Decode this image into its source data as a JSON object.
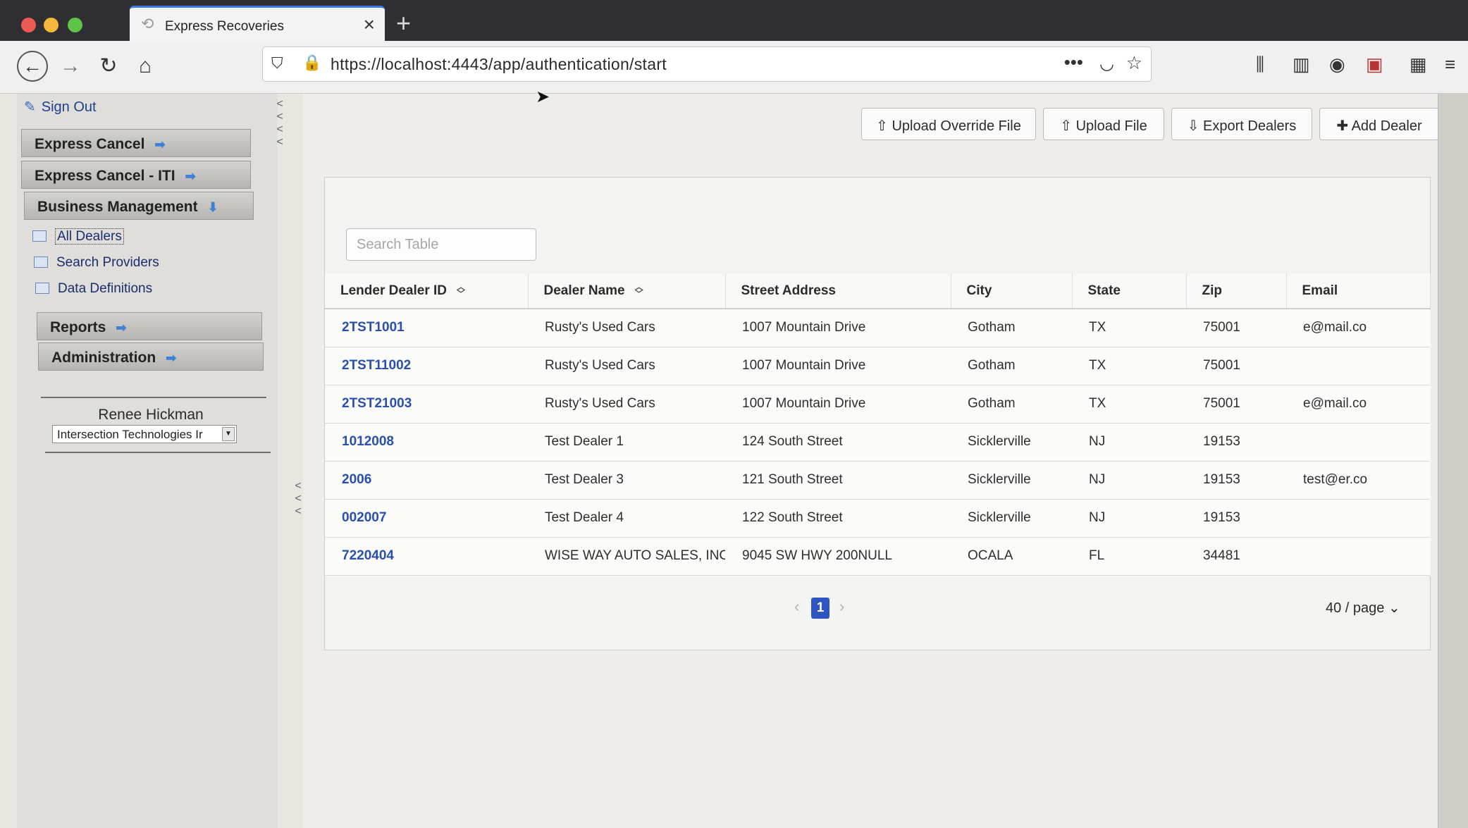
{
  "browser": {
    "tab_title": "Express Recoveries",
    "new_tab": "+",
    "url": "https://localhost:4443/app/authentication/start"
  },
  "sidebar": {
    "sign_out": "Sign Out",
    "sections": [
      {
        "label": "Express Cancel"
      },
      {
        "label": "Express Cancel - ITI"
      },
      {
        "label": "Business Management"
      }
    ],
    "links": [
      {
        "label": "All Dealers"
      },
      {
        "label": "Search Providers"
      },
      {
        "label": "Data Definitions"
      }
    ],
    "sections2": [
      {
        "label": "Reports"
      },
      {
        "label": "Administration"
      }
    ],
    "user_name": "Renee Hickman",
    "org_selected": "Intersection Technologies Ir"
  },
  "toolbar": {
    "upload_override": "Upload Override File",
    "upload_file": "Upload File",
    "export_dealers": "Export Dealers",
    "add_dealer": "Add Dealer"
  },
  "search": {
    "placeholder": "Search Table"
  },
  "table": {
    "columns": [
      "Lender Dealer ID",
      "Dealer Name",
      "Street Address",
      "City",
      "State",
      "Zip",
      "Email"
    ],
    "rows": [
      [
        "2TST1001",
        "Rusty's Used Cars",
        "1007 Mountain Drive",
        "Gotham",
        "TX",
        "75001",
        "e@mail.co"
      ],
      [
        "2TST11002",
        "Rusty's Used Cars",
        "1007 Mountain Drive",
        "Gotham",
        "TX",
        "75001",
        ""
      ],
      [
        "2TST21003",
        "Rusty's Used Cars",
        "1007 Mountain Drive",
        "Gotham",
        "TX",
        "75001",
        "e@mail.co"
      ],
      [
        "1012008",
        "Test Dealer 1",
        "124 South Street",
        "Sicklerville",
        "NJ",
        "19153",
        ""
      ],
      [
        "2006",
        "Test Dealer 3",
        "121 South Street",
        "Sicklerville",
        "NJ",
        "19153",
        "test@er.co"
      ],
      [
        "002007",
        "Test Dealer 4",
        "122 South Street",
        "Sicklerville",
        "NJ",
        "19153",
        ""
      ],
      [
        "7220404",
        "WISE WAY AUTO SALES, INC.",
        "9045 SW HWY 200NULL",
        "OCALA",
        "FL",
        "34481",
        ""
      ]
    ]
  },
  "pagination": {
    "current_page": "1",
    "page_size": "40 / page"
  }
}
